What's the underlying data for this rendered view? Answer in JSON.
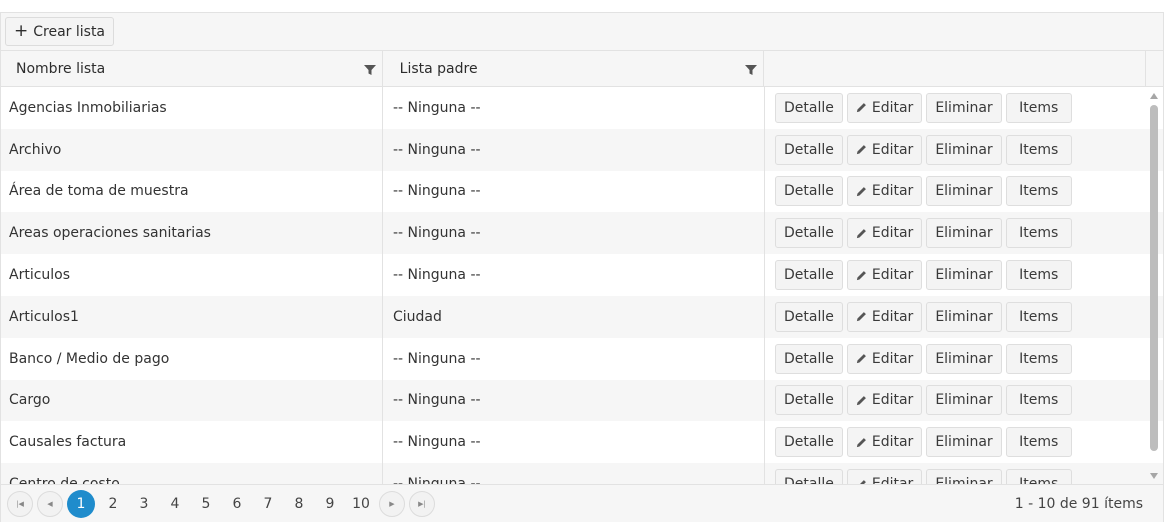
{
  "toolbar": {
    "create_label": "Crear lista"
  },
  "columns": {
    "name": "Nombre lista",
    "parent": "Lista padre"
  },
  "actions": {
    "detail": "Detalle",
    "edit": "Editar",
    "delete": "Eliminar",
    "items": "Items"
  },
  "rows": [
    {
      "name": "Agencias Inmobiliarias",
      "parent": "-- Ninguna --"
    },
    {
      "name": "Archivo",
      "parent": "-- Ninguna --"
    },
    {
      "name": "Área de toma de muestra",
      "parent": "-- Ninguna --"
    },
    {
      "name": "Areas operaciones sanitarias",
      "parent": "-- Ninguna --"
    },
    {
      "name": "Articulos",
      "parent": "-- Ninguna --"
    },
    {
      "name": "Articulos1",
      "parent": "Ciudad"
    },
    {
      "name": "Banco / Medio de pago",
      "parent": "-- Ninguna --"
    },
    {
      "name": "Cargo",
      "parent": "-- Ninguna --"
    },
    {
      "name": "Causales factura",
      "parent": "-- Ninguna --"
    },
    {
      "name": "Centro de costo",
      "parent": "-- Ninguna --"
    }
  ],
  "pager": {
    "pages": [
      "1",
      "2",
      "3",
      "4",
      "5",
      "6",
      "7",
      "8",
      "9",
      "10"
    ],
    "current": "1",
    "info": "1 - 10 de 91 ítems"
  },
  "colors": {
    "accent": "#1f8ccc",
    "header_bg": "#f6f6f6",
    "border": "#e2e2e2"
  }
}
